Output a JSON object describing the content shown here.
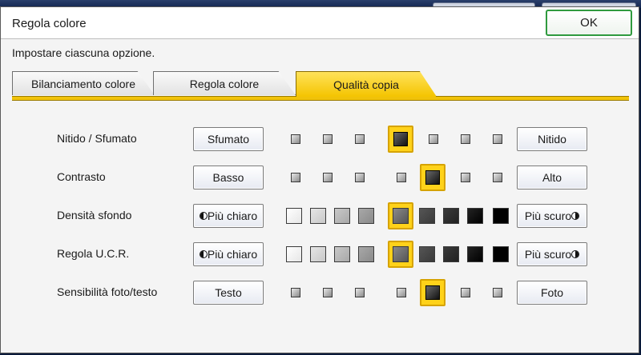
{
  "window": {
    "title": "Regola colore",
    "ok_label": "OK"
  },
  "instruction": "Impostare ciascuna opzione.",
  "tabs": [
    {
      "label": "Bilanciamento colore",
      "active": false
    },
    {
      "label": "Regola colore",
      "active": false
    },
    {
      "label": "Qualità copia",
      "active": true
    }
  ],
  "colors": {
    "accent": "#f4c400",
    "ok_border": "#2f9a3e"
  },
  "rows": [
    {
      "label": "Nitido / Sfumato",
      "left_button": "Sfumato",
      "right_button": "Nitido",
      "style": "dots",
      "selected": 3,
      "left_icon": "",
      "right_icon": ""
    },
    {
      "label": "Contrasto",
      "left_button": "Basso",
      "right_button": "Alto",
      "style": "dots",
      "selected": 4,
      "left_icon": "",
      "right_icon": ""
    },
    {
      "label": "Densità sfondo",
      "left_button": "Più chiaro",
      "right_button": "Più scuro",
      "style": "gradient",
      "selected": 4,
      "left_icon": "half-circle-left-icon",
      "right_icon": "half-circle-right-icon"
    },
    {
      "label": "Regola U.C.R.",
      "left_button": "Più chiaro",
      "right_button": "Più scuro",
      "style": "gradient",
      "selected": 4,
      "left_icon": "half-circle-left-icon",
      "right_icon": "half-circle-right-icon"
    },
    {
      "label": "Sensibilità foto/testo",
      "left_button": "Testo",
      "right_button": "Foto",
      "style": "dots",
      "selected": 4,
      "left_icon": "",
      "right_icon": ""
    }
  ]
}
